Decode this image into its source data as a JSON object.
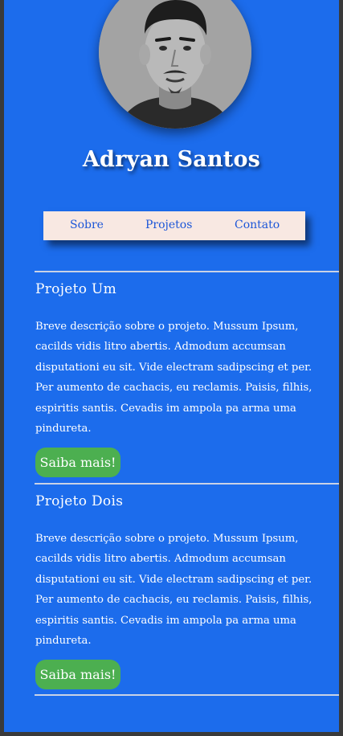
{
  "profile": {
    "name": "Adryan Santos"
  },
  "nav": {
    "items": [
      {
        "label": "Sobre"
      },
      {
        "label": "Projetos"
      },
      {
        "label": "Contato"
      }
    ]
  },
  "projects": [
    {
      "title": "Projeto Um",
      "description": "Breve descrição sobre o projeto. Mussum Ipsum, cacilds vidis litro abertis. Admodum accumsan disputationi eu sit. Vide electram sadipscing et per. Per aumento de cachacis, eu reclamis. Paisis, filhis, espiritis santis. Cevadis im ampola pa arma uma pindureta.",
      "button_label": "Saiba mais!"
    },
    {
      "title": "Projeto Dois",
      "description": "Breve descrição sobre o projeto. Mussum Ipsum, cacilds vidis litro abertis. Admodum accumsan disputationi eu sit. Vide electram sadipscing et per. Per aumento de cachacis, eu reclamis. Paisis, filhis, espiritis santis. Cevadis im ampola pa arma uma pindureta.",
      "button_label": "Saiba mais!"
    }
  ],
  "colors": {
    "background": "#1c6cec",
    "nav_background": "#f8e8e2",
    "nav_link": "#1c56d8",
    "button": "#4caf50"
  }
}
